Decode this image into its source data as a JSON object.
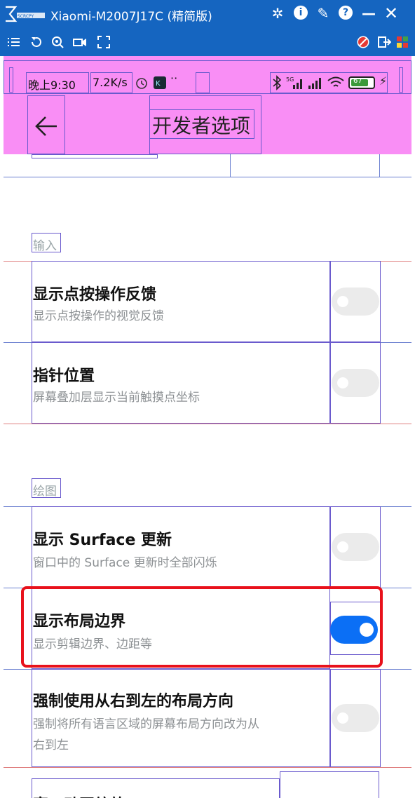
{
  "window": {
    "title": "Xiaomi-M2007J17C (精简版)",
    "logo_text": "SCRCPY",
    "controls": [
      "settings-icon",
      "info-icon",
      "pin-icon",
      "help-icon",
      "minimize-icon",
      "close-icon"
    ]
  },
  "toolbar": {
    "left_icons": [
      "menu-icon",
      "rotate-icon",
      "screenshot-icon",
      "record-icon",
      "fullscreen-icon"
    ],
    "right_icons": [
      "no-touch-icon",
      "exit-icon",
      "apps-grid-icon"
    ]
  },
  "status_bar": {
    "time": "晚上9:30",
    "net_speed": "7.2K/s",
    "more": "··",
    "battery": "67"
  },
  "app_bar": {
    "title": "开发者选项"
  },
  "sections": {
    "input": {
      "label": "输入",
      "items": [
        {
          "title": "显示点按操作反馈",
          "subtitle": "显示点按操作的视觉反馈",
          "enabled": false
        },
        {
          "title": "指针位置",
          "subtitle": "屏幕叠加层显示当前触摸点坐标",
          "enabled": false
        }
      ]
    },
    "drawing": {
      "label": "绘图",
      "items": [
        {
          "title": "显示 Surface 更新",
          "subtitle": "窗口中的 Surface 更新时全部闪烁",
          "enabled": false
        },
        {
          "title": "显示布局边界",
          "subtitle": "显示剪辑边界、边距等",
          "enabled": true
        },
        {
          "title": "强制使用从右到左的布局方向",
          "subtitle_line1": "强制将所有语言区域的屏幕布局方向改为从",
          "subtitle_line2": "右到左",
          "enabled": false
        },
        {
          "title": "窗口动画缩放"
        }
      ]
    }
  },
  "colors": {
    "window_blue": "#1565c0",
    "overlay_magenta": "#f98ef5",
    "toggle_on": "#0b6ff5",
    "highlight_red": "#e8111b"
  }
}
